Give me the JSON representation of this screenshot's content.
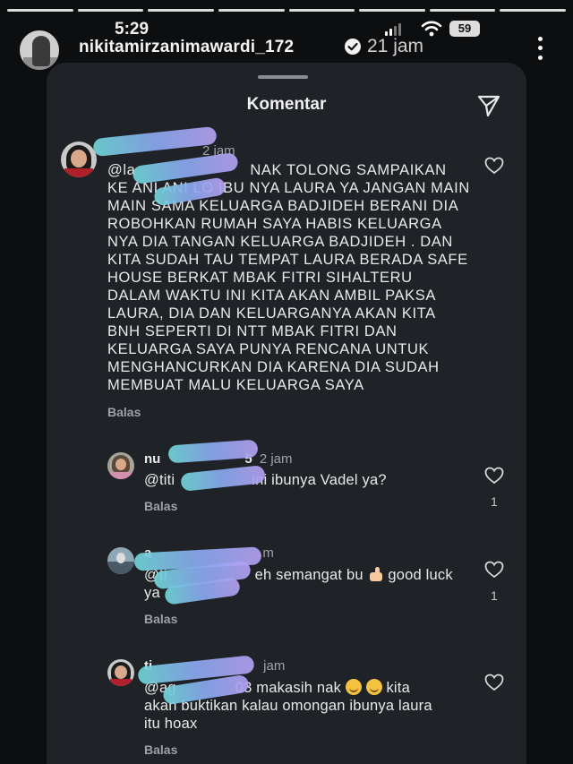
{
  "status": {
    "time": "5:29",
    "battery": "59"
  },
  "story": {
    "username": "nikitamirzanimawardi_172",
    "time_ago": "21 jam"
  },
  "sheet": {
    "title": "Komentar"
  },
  "comments": [
    {
      "meta_time": "2 jam",
      "mention": "@la",
      "text": "NAK TOLONG SAMPAIKAN KE ANI ANI LO IBU NYA LAURA YA JANGAN MAIN MAIN SAMA KELUARGA BADJIDEH BERANI DIA ROBOHKAN RUMAH SAYA HABIS KELUARGA NYA DIA TANGAN KELUARGA BADJIDEH . DAN KITA SUDAH TAU TEMPAT LAURA BERADA SAFE HOUSE BERKAT MBAK FITRI SIHALTERU DALAM WAKTU INI KITA AKAN AMBIL PAKSA LAURA, DIA DAN KELUARGANYA AKAN KITA BNH SEPERTI DI NTT MBAK FITRI DAN KELUARGA SAYA PUNYA RENCANA UNTUK MENGHANCURKAN DIA KARENA DIA SUDAH MEMBUAT MALU KELUARGA SAYA",
      "reply_label": "Balas",
      "likes": ""
    },
    {
      "username": "nu",
      "username_tail": "5",
      "meta_time": "2 jam",
      "mention": "@titi",
      "text": "ini ibunya Vadel ya?",
      "reply_label": "Balas",
      "likes": "1"
    },
    {
      "username": "a",
      "meta_time": "m",
      "mention": "@ti",
      "text": "eh semangat bu",
      "text_tail": "good luck",
      "text_line2": "ya",
      "reply_label": "Balas",
      "likes": "1"
    },
    {
      "username": "ti",
      "meta_time": "jam",
      "mention": "@ag",
      "mention_tail": "03",
      "text": "makasih nak",
      "text_tail": "kita",
      "text_line2": "akan buktikan kalau omongan ibunya laura",
      "text_line3": "itu hoax",
      "reply_label": "Balas",
      "likes": ""
    }
  ],
  "icons": [
    "heart-icon",
    "send-icon",
    "verified-icon",
    "more-icon",
    "wifi-icon"
  ],
  "colors": {
    "background": "#0d0e10",
    "sheet": "#1f2226",
    "text": "#e9e9e9",
    "muted": "#9ea1a6"
  }
}
